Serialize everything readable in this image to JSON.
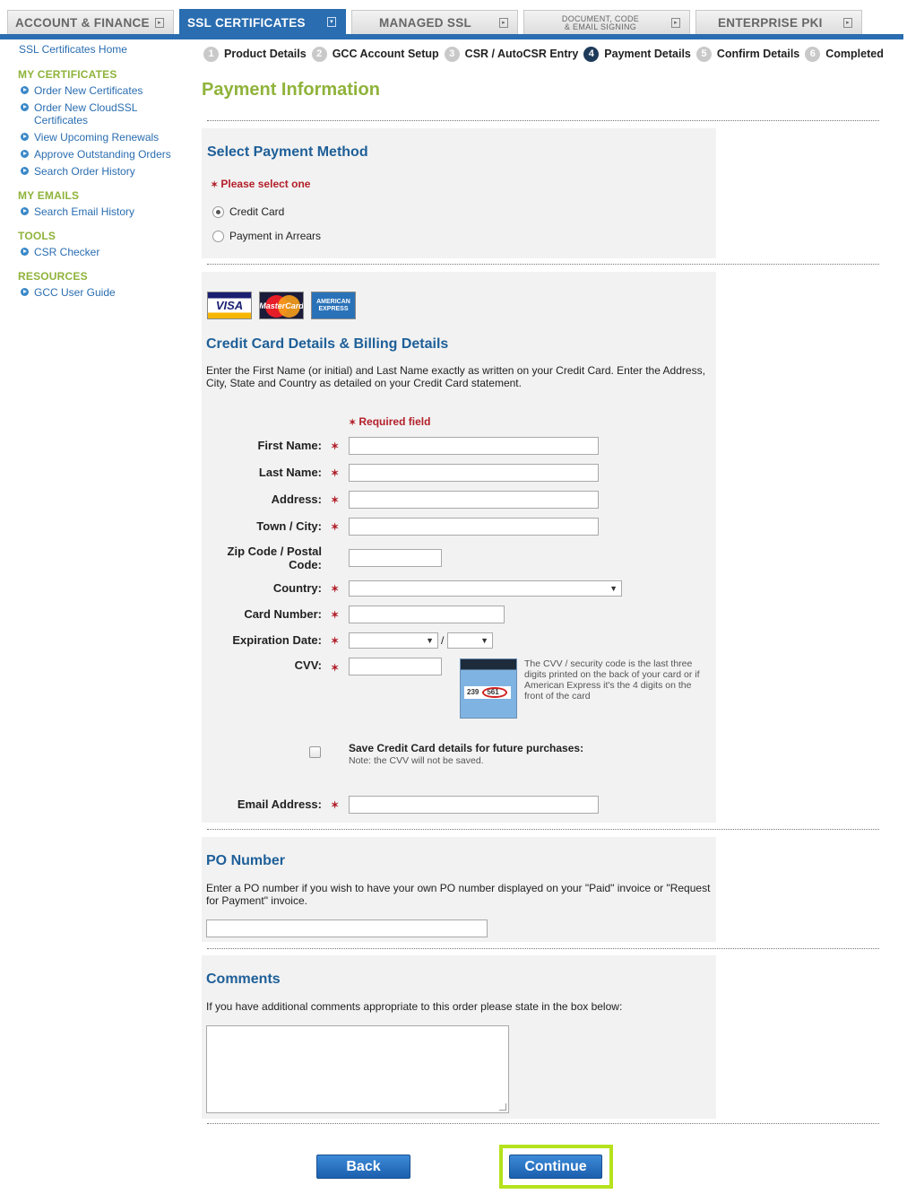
{
  "tabs": [
    {
      "label": "ACCOUNT & FINANCE"
    },
    {
      "label": "SSL CERTIFICATES"
    },
    {
      "label": "MANAGED SSL"
    },
    {
      "label": "DOCUMENT, CODE",
      "label2": "& EMAIL SIGNING"
    },
    {
      "label": "ENTERPRISE PKI"
    }
  ],
  "sidebar": {
    "home": "SSL Certificates Home",
    "sections": [
      {
        "heading": "MY CERTIFICATES",
        "items": [
          "Order New Certificates",
          "Order New CloudSSL",
          "Certificates",
          "View Upcoming Renewals",
          "Approve Outstanding Orders",
          "Search Order History"
        ]
      },
      {
        "heading": "MY EMAILS",
        "items": [
          "Search Email History"
        ]
      },
      {
        "heading": "TOOLS",
        "items": [
          "CSR Checker"
        ]
      },
      {
        "heading": "RESOURCES",
        "items": [
          "GCC User Guide"
        ]
      }
    ]
  },
  "steps": [
    {
      "num": "1",
      "label": "Product Details"
    },
    {
      "num": "2",
      "label": "GCC Account Setup"
    },
    {
      "num": "3",
      "label": "CSR / AutoCSR Entry"
    },
    {
      "num": "4",
      "label": "Payment Details"
    },
    {
      "num": "5",
      "label": "Confirm Details"
    },
    {
      "num": "6",
      "label": "Completed"
    }
  ],
  "page_title": "Payment Information",
  "payment_method": {
    "title": "Select Payment Method",
    "required_note": "Please select one",
    "options": [
      {
        "label": "Credit Card",
        "selected": true
      },
      {
        "label": "Payment in Arrears",
        "selected": false
      }
    ]
  },
  "card_logos": {
    "visa": "VISA",
    "mastercard": "MasterCard",
    "amex_line1": "AMERICAN",
    "amex_line2": "EXPRESS"
  },
  "billing": {
    "title": "Credit Card Details & Billing Details",
    "intro": "Enter the First Name (or initial) and Last Name exactly as written on your Credit Card. Enter the Address, City, State and Country as detailed on your Credit Card statement.",
    "required_field": "Required field",
    "labels": {
      "first_name": "First Name:",
      "last_name": "Last Name:",
      "address": "Address:",
      "town": "Town / City:",
      "zip_line1": "Zip Code / Postal",
      "zip_line2": "Code:",
      "country": "Country:",
      "card_number": "Card Number:",
      "expiration": "Expiration Date:",
      "cvv": "CVV:",
      "email": "Email Address:"
    },
    "exp_separator": "/",
    "cvv_image_text": "239",
    "cvv_image_code": "561",
    "cvv_help": "The CVV / security code is the last three digits printed on the back of your card or if American Express it's the 4 digits on the front of the card",
    "save_label": "Save Credit Card details for future purchases:",
    "save_note": "Note: the CVV will not be saved."
  },
  "po": {
    "title": "PO Number",
    "text": "Enter a PO number if you wish to have your own PO number displayed on your \"Paid\" invoice or \"Request for Payment\" invoice."
  },
  "comments": {
    "title": "Comments",
    "text": "If you have additional comments appropriate to this order please state in the box below:"
  },
  "buttons": {
    "back": "Back",
    "continue": "Continue"
  },
  "colors": {
    "brand_blue": "#2a6db0",
    "accent_green": "#8fb33a",
    "required_red": "#b3202a",
    "highlight": "#b5e21c"
  }
}
